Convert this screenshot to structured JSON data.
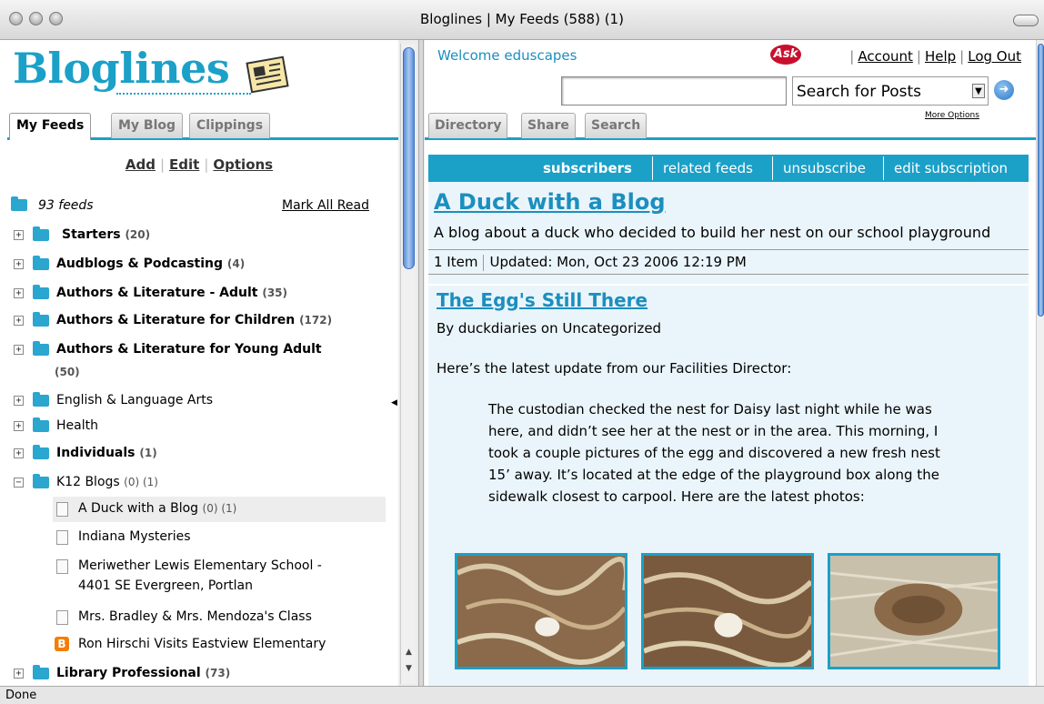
{
  "window": {
    "title": "Bloglines | My Feeds (588) (1)"
  },
  "logo": {
    "text": "Bloglines"
  },
  "left_tabs": [
    "My Feeds",
    "My Blog",
    "Clippings"
  ],
  "actions": {
    "add": "Add",
    "edit": "Edit",
    "options": "Options"
  },
  "feeds_header": {
    "count": "93 feeds",
    "mark_all_read": "Mark All Read"
  },
  "tree": [
    {
      "name": "Starters",
      "count": "(20)",
      "bold": true
    },
    {
      "name": "Audblogs & Podcasting",
      "count": "(4)",
      "bold": true
    },
    {
      "name": "Authors & Literature - Adult",
      "count": "(35)",
      "bold": true
    },
    {
      "name": "Authors & Literature for Children",
      "count": "(172)",
      "bold": true
    },
    {
      "name": "Authors & Literature for Young Adult",
      "count": "(50)",
      "bold": true
    },
    {
      "name": "English & Language Arts",
      "count": "",
      "bold": false
    },
    {
      "name": "Health",
      "count": "",
      "bold": false
    },
    {
      "name": "Individuals",
      "count": "(1)",
      "bold": true
    },
    {
      "name": "K12 Blogs",
      "count": "(0) (1)",
      "bold": false
    },
    {
      "name": "A Duck with a Blog",
      "count": "(0) (1)"
    },
    {
      "name": "Indiana Mysteries"
    },
    {
      "name": "Meriwether Lewis Elementary School -",
      "line2": "4401 SE Evergreen, Portlan"
    },
    {
      "name": "Mrs. Bradley & Mrs. Mendoza's Class"
    },
    {
      "name": "Ron Hirschi Visits Eastview Elementary"
    },
    {
      "name": "Library Professional",
      "count": "(73)",
      "bold": true
    }
  ],
  "header": {
    "welcome": "Welcome eduscapes",
    "ask_logo": "Ask",
    "links": {
      "account": "Account",
      "help": "Help",
      "logout": "Log Out"
    },
    "search_input_value": "",
    "search_select": "Search for Posts",
    "more_options": "More Options"
  },
  "right_tabs": [
    "Directory",
    "Share",
    "Search"
  ],
  "feed_actions": [
    "subscribers",
    "related feeds",
    "unsubscribe",
    "edit subscription"
  ],
  "feed": {
    "title": "A Duck with a Blog",
    "description": "A blog about a duck who decided to build her nest on our school playground",
    "items": "1 Item",
    "updated": "Updated: Mon, Oct 23 2006 12:19 PM"
  },
  "post": {
    "title": "The Egg's Still There",
    "byline": "By duckdiaries on Uncategorized",
    "intro": "Here’s the latest update from our Facilities Director:",
    "quote": "The custodian checked the nest for Daisy last night while he was here, and didn’t see her at the nest or in the area. This morning, I took a couple pictures of the egg and discovered a new fresh nest 15’ away. It’s located at the edge of the playground box along the sidewalk closest to carpool. Here are the latest photos:"
  },
  "status": {
    "text": "Done"
  },
  "colors": {
    "accent": "#1ba0c8",
    "link": "#1b8fbf",
    "panel_bg": "#eaf5fb"
  }
}
